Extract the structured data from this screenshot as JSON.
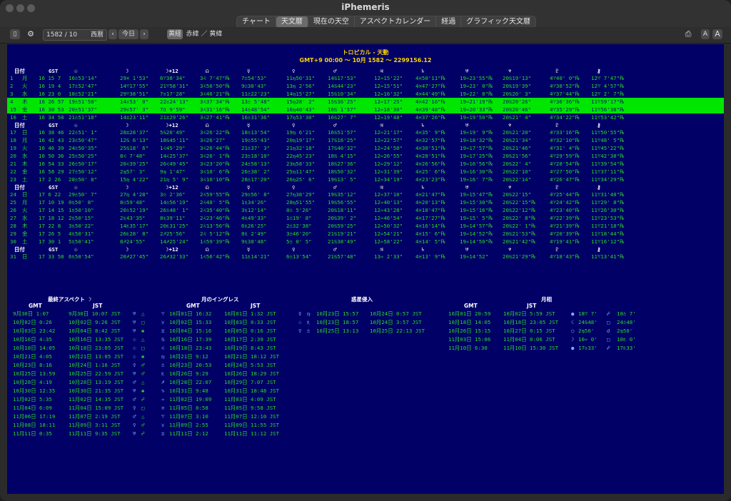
{
  "window": {
    "title": "iPhemeris"
  },
  "tabs": [
    "チャート",
    "天文暦",
    "現在の天空",
    "アスペクトカレンダー",
    "経過",
    "グラフィック天文暦"
  ],
  "active_tab": 1,
  "toolbar": {
    "year": "1582",
    "month": "10",
    "calendar": "西暦",
    "prev": "‹",
    "today": "今日",
    "next": "›",
    "coord_ecl": "黄経",
    "coord_rest": "赤緯 ／ 黄緯",
    "font_small": "A",
    "font_large": "A"
  },
  "header": {
    "title": "トロピカル - 天動",
    "subtitle": "GMT+9 00:00 ～ 10月 1582 ～ 2299156.12"
  },
  "columns": [
    "日付",
    "GST",
    "☉",
    "☽",
    "☽+12",
    "☊",
    "☿",
    "♀",
    "♂",
    "♃",
    "♄",
    "♅",
    "♆",
    "♇",
    "⚷"
  ],
  "blocks": [
    {
      "rows": [
        {
          "d": "1",
          "w": "月",
          "g": "16 15  7",
          "c": [
            "16♎53'14\"",
            "29♓ 1'53\"",
            "6♈38'34\"",
            "3♌ 7'47\"℞",
            "7♎54'53\"",
            "11♍50'31\"",
            "14♋17'53\"",
            "12♒15'22\"",
            "4♓50'11\"℞",
            "19♒23'55\"℞",
            "20♋19'13\"",
            "4♈40' 0\"℞",
            "12♈ 7'47\"℞"
          ]
        },
        {
          "d": "2",
          "w": "火",
          "g": "16 19  4",
          "c": [
            "17♎52'47\"",
            "14♈17'55\"",
            "21♈58'31\"",
            "3♌56'50\"℞",
            "9♎38'43\"",
            "13♍ 2'56\"",
            "14♋44'23\"",
            "12♒15'51\"",
            "4♓47'27\"℞",
            "19♒23' 0\"℞",
            "20♋19'39\"",
            "4♈38'52\"℞",
            "12♈ 4'57\"℞"
          ]
        },
        {
          "d": "3",
          "w": "水",
          "g": "16 23  0",
          "c": [
            "18♎52'21\"",
            "29♈38'51\"",
            "7♉17'28\"",
            "3♌46'21\"℞",
            "11♎22'23\"",
            "14♍15'27\"",
            "15♋10'34\"",
            "12♒16'32\"",
            "4♓44'49\"℞",
            "19♒22' 8\"℞",
            "20♋20' 3\"",
            "4♈37'44\"℞",
            "12♈ 2' 7\"℞"
          ]
        },
        {
          "d": "4",
          "w": "木",
          "g": "16 26 57",
          "c": [
            "19♎51'58\"",
            "14♉53' 0\"",
            "22♉24'13\"",
            "3♌37'34\"℞",
            "13♎ 5'48\"",
            "15♍28' 2\"",
            "15♋36'25\"",
            "12♒17'25\"",
            "4♓42'16\"℞",
            "19♒21'19\"℞",
            "20♋20'26\"",
            "4♈36'36\"℞",
            "11♈59'17\"℞"
          ],
          "hl": true
        },
        {
          "d": "15",
          "w": "金",
          "g": "16 30 53",
          "c": [
            "20♎51'37\"",
            "29♉57' 3\"",
            "7♊ 9'59\"",
            "3♌31'16\"℞",
            "14♎48'54\"",
            "16♍40'43\"",
            "16♋ 1'57\"",
            "12♒18'30\"",
            "4♓39'48\"℞",
            "19♒20'33\"℞",
            "20♋20'46\"",
            "4♈35'29\"℞",
            "11♈56'38\"℞"
          ],
          "hl": true
        },
        {
          "d": "16",
          "w": "土",
          "g": "16 34 50",
          "c": [
            "21♎51'18\"",
            "14♊23'11\"",
            "21♊29'26\"",
            "3♌27'41\"℞",
            "16♎31'36\"",
            "17♍53'30\"",
            "16♋27' 7\"",
            "12♒19'48\"",
            "4♓37'26\"℞",
            "19♒19'50\"℞",
            "20♋21' 4\"",
            "4♈34'22\"℞",
            "11♈53'42\"℞"
          ]
        }
      ]
    },
    {
      "rows": [
        {
          "d": "17",
          "w": "日",
          "g": "16 38 46",
          "c": [
            "22♎51' 1\"",
            "28♊28'37\"",
            "5♋20'49\"",
            "3♌26'22\"℞",
            "18♎13'54\"",
            "19♍ 6'21\"",
            "16♋51'57\"",
            "12♒21'17\"",
            "4♓35' 9\"℞",
            "19♒19' 9\"℞",
            "20♋21'20\"",
            "4♈33'16\"℞",
            "11♈50'55\"℞"
          ]
        },
        {
          "d": "18",
          "w": "月",
          "g": "16 42 43",
          "c": [
            "23♎50'47\"",
            "12♋ 6'13\"",
            "18♋45'11\"",
            "3♌26'27\"",
            "19♎55'43\"",
            "20♍19'17\"",
            "17♋16'25\"",
            "12♒22'57\"",
            "4♓32'57\"℞",
            "19♒18'32\"℞",
            "20♋21'34\"",
            "4♈32'10\"℞",
            "11♈48' 5\"℞"
          ]
        },
        {
          "d": "19",
          "w": "火",
          "g": "16 46 39",
          "c": [
            "24♎50'35\"",
            "25♋18' 6\"",
            "1♌45'29\"",
            "3♌26'44\"℞",
            "21♎37' 3\"",
            "21♍32'18\"",
            "17♋40'32\"",
            "12♒24'50\"",
            "4♓30'51\"℞",
            "19♒17'57\"℞",
            "20♋21'46\"",
            "4♈31' 4\"℞",
            "11♈45'22\"℞"
          ]
        },
        {
          "d": "20",
          "w": "水",
          "g": "16 50 36",
          "c": [
            "25♎50'25\"",
            "8♌ 7'48\"",
            "14♌25'37\"",
            "3♌26' 1\"℞",
            "23♎18'10\"",
            "22♍45'23\"",
            "18♋ 4'15\"",
            "12♒26'55\"",
            "4♓28'51\"℞",
            "19♒17'25\"℞",
            "20♋21'56\"",
            "4♈29'59\"℞",
            "11♈42'38\"℞"
          ]
        },
        {
          "d": "21",
          "w": "木",
          "g": "16 54 33",
          "c": [
            "26♎50'17\"",
            "20♌39'25\"",
            "26♌49'45\"",
            "3♌23'20\"℞",
            "24♎58'13\"",
            "23♍58'33\"",
            "18♋27'36\"",
            "12♒29'12\"",
            "4♓26'56\"℞",
            "19♒16'56\"℞",
            "20♋22' 4\"",
            "4♈28'54\"℞",
            "11♈39'54\"℞"
          ]
        },
        {
          "d": "22",
          "w": "金",
          "g": "16 58 29",
          "c": [
            "27♎50'12\"",
            "2♍57' 3\"",
            "9♍ 1'47\"",
            "3♌18' 6\"℞",
            "26♎38' 2\"",
            "25♍11'47\"",
            "18♋50'32\"",
            "12♒31'39\"",
            "4♓25' 6\"℞",
            "19♒16'30\"℞",
            "20♋22'10\"",
            "4♈27'50\"℞",
            "11♈37'11\"℞"
          ]
        },
        {
          "d": "23",
          "w": "土",
          "g": "17  2 26",
          "c": [
            "28♎50' 8\"",
            "15♍ 4'22\"",
            "21♍ 5' 9\"",
            "3♌10'10\"℞",
            "28♎17'20\"",
            "26♍25' 6\"",
            "19♋13' 5\"",
            "12♒34'19\"",
            "4♓23'23\"℞",
            "19♒16' 7\"℞",
            "20♋22'14\"",
            "4♈26'47\"℞",
            "11♈34'29\"℞"
          ]
        }
      ]
    },
    {
      "rows": [
        {
          "d": "24",
          "w": "日",
          "g": "17  6 22",
          "c": [
            "29♎50' 7\"",
            "27♍ 4'28\"",
            "3♎ 2'36\"",
            "2♌59'55\"℞",
            "29♎56' 8\"",
            "27♍38'29\"",
            "19♋35'12\"",
            "12♒37'10\"",
            "4♓21'47\"℞",
            "19♒15'47\"℞",
            "20♋22'15\"",
            "4♈25'44\"℞",
            "11♈31'48\"℞"
          ]
        },
        {
          "d": "25",
          "w": "月",
          "g": "17 10 19",
          "c": [
            "0♏50' 8\"",
            "8♎59'48\"",
            "14♎56'19\"",
            "2♌48' 5\"℞",
            "1♏34'26\"",
            "28♍51'55\"",
            "19♋56'55\"",
            "12♒40'13\"",
            "4♓20'13\"℞",
            "19♒15'30\"℞",
            "20♋22'15\"℞",
            "4♈24'42\"℞",
            "11♈29' 8\"℞"
          ]
        },
        {
          "d": "26",
          "w": "火",
          "g": "17 14 15",
          "c": [
            "1♏50'10\"",
            "20♎52'19\"",
            "26♎48' 1\"",
            "2♌35'40\"℞",
            "3♏12'14\"",
            "0♎ 5'26\"",
            "20♋18'11\"",
            "12♒43'28\"",
            "4♓18'47\"℞",
            "19♒15'16\"℞",
            "20♋22'12\"℞",
            "4♈23'40\"℞",
            "11♈26'30\"℞"
          ]
        },
        {
          "d": "27",
          "w": "水",
          "g": "17 18 12",
          "c": [
            "2♏50'15\"",
            "2♏43'35\"",
            "8♏39'11\"",
            "2♌23'46\"℞",
            "4♏49'33\"",
            "1♎19' 8\"",
            "20♋39' 2\"",
            "12♒46'54\"",
            "4♓17'27\"℞",
            "19♒15' 5\"℞",
            "20♋22' 8\"℞",
            "4♈22'39\"℞",
            "11♈23'53\"℞"
          ]
        },
        {
          "d": "28",
          "w": "木",
          "g": "17 22  8",
          "c": [
            "3♏50'22\"",
            "14♏35'17\"",
            "20♏31'25\"",
            "2♌13'56\"℞",
            "6♏26'25\"",
            "2♎32'38\"",
            "20♋59'25\"",
            "12♒50'32\"",
            "4♓16'14\"℞",
            "19♒14'57\"℞",
            "20♋22' 1\"℞",
            "4♈21'39\"℞",
            "11♈21'18\"℞"
          ]
        },
        {
          "d": "29",
          "w": "金",
          "g": "17 26  5",
          "c": [
            "4♏50'31\"",
            "26♏28' 8\"",
            "2♐25'56\"",
            "2♌ 5'12\"℞",
            "8♏ 2'49\"",
            "3♎46'20\"",
            "21♋19'21\"",
            "12♒54'21\"",
            "4♓15' 6\"℞",
            "19♒14'52\"℞",
            "20♋21'53\"℞",
            "4♈20'39\"℞",
            "11♈18'44\"℞"
          ]
        },
        {
          "d": "30",
          "w": "土",
          "g": "17 30  1",
          "c": [
            "5♏50'41\"",
            "8♐24'55\"",
            "14♐25'24\"",
            "1♌59'39\"℞",
            "9♏38'48\"",
            "5♎ 0' 5\"",
            "21♋38'49\"",
            "12♒58'22\"",
            "4♓14' 5\"℞",
            "19♒14'50\"℞",
            "20♋21'42\"℞",
            "4♈19'41\"℞",
            "11♈16'12\"℞"
          ]
        }
      ]
    },
    {
      "rows": [
        {
          "d": "31",
          "w": "日",
          "g": "17 33 58",
          "c": [
            "6♏50'54\"",
            "20♐27'45\"",
            "26♐32'33\"",
            "1♌56'42\"℞",
            "11♏14'21\"",
            "6♎13'54\"",
            "21♋57'48\"",
            "13♒ 2'33\"",
            "4♓13' 9\"℞",
            "19♒14'52\"",
            "20♋21'29\"℞",
            "4♈18'43\"℞",
            "11♈13'41\"℞"
          ]
        }
      ]
    }
  ],
  "bottom": {
    "aspects": {
      "title": "最終アスペクト ☽",
      "gmt": "GMT",
      "jst": "JST",
      "rows": [
        [
          "9月30日 1:07",
          "9月30日 10:07 JST",
          "♅",
          "△"
        ],
        [
          "10月02日 0:26",
          "10月02日 9:26 JST",
          "♅",
          "□"
        ],
        [
          "10月03日 23:42",
          "10月04日 8:42 JST",
          "♅",
          "✱"
        ],
        [
          "10月16日 4:35",
          "10月16日 13:35 JST",
          "☉",
          "△"
        ],
        [
          "10月18日 14:05",
          "10月18日 23:05 JST",
          "☉",
          "□"
        ],
        [
          "10月21日 4:05",
          "10月21日 13:05 JST",
          "☉",
          "✱"
        ],
        [
          "10月23日 8:16",
          "10月24日 1:16 JST",
          "♀",
          "♂"
        ],
        [
          "10月25日 13:59",
          "10月25日 22:59 JST",
          "♅",
          "♂"
        ],
        [
          "10月28日 4:19",
          "10月28日 13:19 JST",
          "♂",
          "△"
        ],
        [
          "10月30日 12:35",
          "10月30日 21:35 JST",
          "♅",
          "✱"
        ],
        [
          "11月02日 5:35",
          "11月02日 14:35 JST",
          "♂",
          "☍"
        ],
        [
          "11月04日 6:09",
          "11月04日 15:09 JST",
          "♀",
          "□"
        ],
        [
          "11月06日 17:19",
          "11月07日 2:19 JST",
          "♂",
          "△"
        ],
        [
          "11月08日 18:11",
          "11月09日 3:11 JST",
          "♀",
          "♂"
        ],
        [
          "11月11日 0:35",
          "11月11日 9:35 JST",
          "♅",
          "☍"
        ]
      ]
    },
    "ingress": {
      "title": "月のイングレス",
      "gmt": "GMT",
      "jst": "JST",
      "rows": [
        [
          "♈",
          "10月01日 16:32",
          "10月01日 1:32 JST"
        ],
        [
          "♉",
          "10月02日 15:33",
          "10月03日 0:33 JST"
        ],
        [
          "♊",
          "10月04日 15:16",
          "10月05日 0:16 JST"
        ],
        [
          "♋",
          "10月16日 17:39",
          "10月17日 2:39 JST"
        ],
        [
          "♌",
          "10月18日 23:43",
          "10月19日 8:43 JST"
        ],
        [
          "♍",
          "10月21日 9:12",
          "10月21日 18:12 JST"
        ],
        [
          "♎",
          "10月23日 20:53",
          "10月24日 5:53 JST"
        ],
        [
          "♏",
          "10月26日 9:29",
          "10月26日 18:29 JST"
        ],
        [
          "♐",
          "10月28日 22:07",
          "10月29日 7:07 JST"
        ],
        [
          "♑",
          "10月31日 9:48",
          "10月31日 18:48 JST"
        ],
        [
          "♒",
          "11月02日 19:09",
          "11月03日 4:09 JST"
        ],
        [
          "♓",
          "11月05日 0:58",
          "11月05日 9:58 JST"
        ],
        [
          "♈",
          "11月07日 3:10",
          "11月07日 12:10 JST"
        ],
        [
          "♉",
          "11月09日 2:55",
          "11月09日 11:55 JST"
        ],
        [
          "♊",
          "11月11日 2:12",
          "11月11日 11:12 JST"
        ]
      ]
    },
    "planet_ingress": {
      "title": "惑星侵入",
      "rows": [
        [
          "☿",
          "♍",
          "10月23日 15:57",
          "10月24日 0:57 JST"
        ],
        [
          "☉",
          "♏",
          "10月23日 18:57",
          "10月24日 3:57 JST"
        ],
        [
          "♀",
          "♎",
          "10月25日 13:13",
          "10月25日 22:13 JST"
        ]
      ]
    },
    "lunations": {
      "title": "月相",
      "gmt": "GMT",
      "jst": "JST",
      "rows": [
        [
          "10月01日 20:59",
          "10月02日 5:59 JST",
          "●",
          "18♈ 7'",
          "☍",
          "18♎ 7'"
        ],
        [
          "10月18日 14:05",
          "10月18日 23:05 JST",
          "☾",
          "24♋48'",
          "□",
          "24♎48'"
        ],
        [
          "10月26日 15:15",
          "10月27日 0:15 JST",
          "○",
          "2♍50'",
          "☌",
          "2♍50'"
        ],
        [
          "11月03日 15:06",
          "11月04日 0:06 JST",
          "☽",
          "10♒ 0'",
          "□",
          "10♏ 0'"
        ],
        [
          "11月10日 6:30",
          "11月10日 15:30 JST",
          "●",
          "17♉33'",
          "☍",
          "17♏33'"
        ]
      ]
    }
  }
}
